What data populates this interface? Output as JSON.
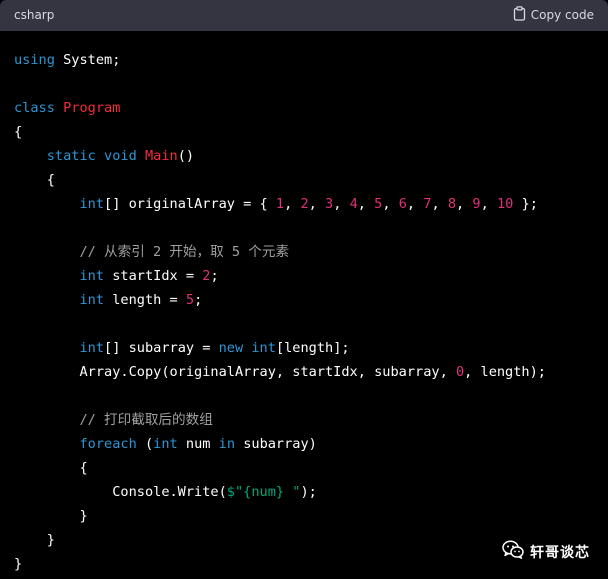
{
  "header": {
    "language": "csharp",
    "copy_label": "Copy code"
  },
  "colors": {
    "keyword": "#2e95d3",
    "class_name": "#f22c3d",
    "number": "#df3079",
    "string": "#00a67d",
    "comment": "#a0a0a0",
    "plain": "#ffffff",
    "header_bg": "#343541",
    "code_bg": "#000000"
  },
  "code": {
    "lines": [
      [
        {
          "t": "using",
          "c": "kw"
        },
        {
          "t": " System;",
          "c": "pl"
        }
      ],
      [],
      [
        {
          "t": "class",
          "c": "kw"
        },
        {
          "t": " ",
          "c": "pl"
        },
        {
          "t": "Program",
          "c": "cls"
        }
      ],
      [
        {
          "t": "{",
          "c": "pl"
        }
      ],
      [
        {
          "t": "    ",
          "c": "pl"
        },
        {
          "t": "static",
          "c": "kw"
        },
        {
          "t": " ",
          "c": "pl"
        },
        {
          "t": "void",
          "c": "kw"
        },
        {
          "t": " ",
          "c": "pl"
        },
        {
          "t": "Main",
          "c": "cls"
        },
        {
          "t": "()",
          "c": "pl"
        }
      ],
      [
        {
          "t": "    {",
          "c": "pl"
        }
      ],
      [
        {
          "t": "        ",
          "c": "pl"
        },
        {
          "t": "int",
          "c": "ty"
        },
        {
          "t": "[] originalArray = { ",
          "c": "pl"
        },
        {
          "t": "1",
          "c": "num"
        },
        {
          "t": ", ",
          "c": "pl"
        },
        {
          "t": "2",
          "c": "num"
        },
        {
          "t": ", ",
          "c": "pl"
        },
        {
          "t": "3",
          "c": "num"
        },
        {
          "t": ", ",
          "c": "pl"
        },
        {
          "t": "4",
          "c": "num"
        },
        {
          "t": ", ",
          "c": "pl"
        },
        {
          "t": "5",
          "c": "num"
        },
        {
          "t": ", ",
          "c": "pl"
        },
        {
          "t": "6",
          "c": "num"
        },
        {
          "t": ", ",
          "c": "pl"
        },
        {
          "t": "7",
          "c": "num"
        },
        {
          "t": ", ",
          "c": "pl"
        },
        {
          "t": "8",
          "c": "num"
        },
        {
          "t": ", ",
          "c": "pl"
        },
        {
          "t": "9",
          "c": "num"
        },
        {
          "t": ", ",
          "c": "pl"
        },
        {
          "t": "10",
          "c": "num"
        },
        {
          "t": " };",
          "c": "pl"
        }
      ],
      [],
      [
        {
          "t": "        ",
          "c": "pl"
        },
        {
          "t": "// 从索引 2 开始，取 5 个元素",
          "c": "cm"
        }
      ],
      [
        {
          "t": "        ",
          "c": "pl"
        },
        {
          "t": "int",
          "c": "ty"
        },
        {
          "t": " startIdx = ",
          "c": "pl"
        },
        {
          "t": "2",
          "c": "num"
        },
        {
          "t": ";",
          "c": "pl"
        }
      ],
      [
        {
          "t": "        ",
          "c": "pl"
        },
        {
          "t": "int",
          "c": "ty"
        },
        {
          "t": " length = ",
          "c": "pl"
        },
        {
          "t": "5",
          "c": "num"
        },
        {
          "t": ";",
          "c": "pl"
        }
      ],
      [],
      [
        {
          "t": "        ",
          "c": "pl"
        },
        {
          "t": "int",
          "c": "ty"
        },
        {
          "t": "[] subarray = ",
          "c": "pl"
        },
        {
          "t": "new",
          "c": "kw"
        },
        {
          "t": " ",
          "c": "pl"
        },
        {
          "t": "int",
          "c": "ty"
        },
        {
          "t": "[length];",
          "c": "pl"
        }
      ],
      [
        {
          "t": "        Array.Copy(originalArray, startIdx, subarray, ",
          "c": "pl"
        },
        {
          "t": "0",
          "c": "num"
        },
        {
          "t": ", length);",
          "c": "pl"
        }
      ],
      [],
      [
        {
          "t": "        ",
          "c": "pl"
        },
        {
          "t": "// 打印截取后的数组",
          "c": "cm"
        }
      ],
      [
        {
          "t": "        ",
          "c": "pl"
        },
        {
          "t": "foreach",
          "c": "kw"
        },
        {
          "t": " (",
          "c": "pl"
        },
        {
          "t": "int",
          "c": "ty"
        },
        {
          "t": " num ",
          "c": "pl"
        },
        {
          "t": "in",
          "c": "kw"
        },
        {
          "t": " subarray)",
          "c": "pl"
        }
      ],
      [
        {
          "t": "        {",
          "c": "pl"
        }
      ],
      [
        {
          "t": "            Console.Write(",
          "c": "pl"
        },
        {
          "t": "$\"{num} \"",
          "c": "str"
        },
        {
          "t": ");",
          "c": "pl"
        }
      ],
      [
        {
          "t": "        }",
          "c": "pl"
        }
      ],
      [
        {
          "t": "    }",
          "c": "pl"
        }
      ],
      [
        {
          "t": "}",
          "c": "pl"
        }
      ]
    ]
  },
  "watermark": {
    "icon": "wechat-icon",
    "text": "轩哥谈芯"
  }
}
